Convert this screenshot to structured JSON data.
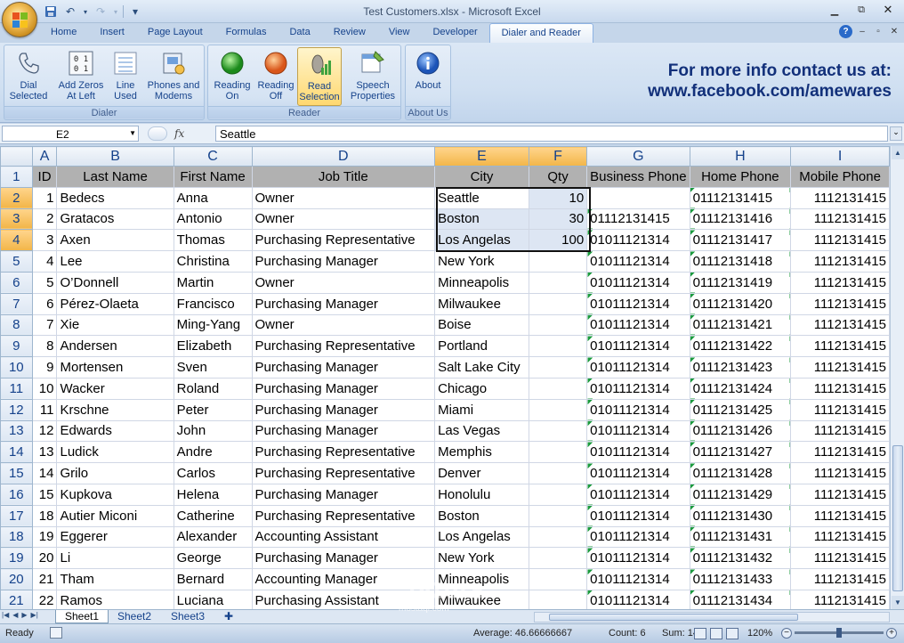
{
  "window": {
    "title": "Test Customers.xlsx - Microsoft Excel",
    "minimize": "▭",
    "restore": "⧉",
    "close": "✕"
  },
  "quick_access": {
    "save_icon": "💾",
    "undo_icon": "↶",
    "redo_icon": "↷",
    "customize_icon": "▾"
  },
  "tabs": [
    "Home",
    "Insert",
    "Page Layout",
    "Formulas",
    "Data",
    "Review",
    "View",
    "Developer",
    "Dialer and Reader"
  ],
  "active_tab": "Dialer and Reader",
  "ribbon": {
    "groups": [
      {
        "label": "Dialer",
        "buttons": [
          {
            "label": "Dial\nSelected",
            "icon": "phone-icon"
          },
          {
            "label": "Add Zeros\nAt Left",
            "icon": "zeros-icon"
          },
          {
            "label": "Line\nUsed",
            "icon": "line-icon"
          },
          {
            "label": "Phones and\nModems",
            "icon": "modem-icon"
          }
        ]
      },
      {
        "label": "Reader",
        "buttons": [
          {
            "label": "Reading\nOn",
            "icon": "green-circle-icon"
          },
          {
            "label": "Reading\nOff",
            "icon": "orange-circle-icon"
          },
          {
            "label": "Read\nSelection",
            "icon": "speaker-icon"
          },
          {
            "label": "Speech\nProperties",
            "icon": "speech-properties-icon"
          }
        ]
      },
      {
        "label": "About Us",
        "buttons": [
          {
            "label": "About",
            "icon": "info-icon"
          }
        ]
      }
    ],
    "promo_line1": "For more info contact us at:",
    "promo_line2": "www.facebook.com/amewares"
  },
  "formula_bar": {
    "name_box": "E2",
    "fx": "fx",
    "value": "Seattle"
  },
  "columns": [
    "A",
    "B",
    "C",
    "D",
    "E",
    "F",
    "G",
    "H",
    "I"
  ],
  "selected_columns": [
    "E",
    "F"
  ],
  "header_row": [
    "ID",
    "Last Name",
    "First Name",
    "Job Title",
    "City",
    "Qty",
    "Business Phone",
    "Home Phone",
    "Mobile Phone"
  ],
  "rows": [
    [
      "1",
      "Bedecs",
      "Anna",
      "Owner",
      "Seattle",
      "10",
      "",
      "01112131415",
      "1112131415"
    ],
    [
      "2",
      "Gratacos",
      "Antonio",
      "Owner",
      "Boston",
      "30",
      "01112131415",
      "01112131416",
      "1112131415"
    ],
    [
      "3",
      "Axen",
      "Thomas",
      "Purchasing Representative",
      "Los Angelas",
      "100",
      "01011121314",
      "01112131417",
      "1112131415"
    ],
    [
      "4",
      "Lee",
      "Christina",
      "Purchasing Manager",
      "New York",
      "",
      "01011121314",
      "01112131418",
      "1112131415"
    ],
    [
      "5",
      "O’Donnell",
      "Martin",
      "Owner",
      "Minneapolis",
      "",
      "01011121314",
      "01112131419",
      "1112131415"
    ],
    [
      "6",
      "Pérez-Olaeta",
      "Francisco",
      "Purchasing Manager",
      "Milwaukee",
      "",
      "01011121314",
      "01112131420",
      "1112131415"
    ],
    [
      "7",
      "Xie",
      "Ming-Yang",
      "Owner",
      "Boise",
      "",
      "01011121314",
      "01112131421",
      "1112131415"
    ],
    [
      "8",
      "Andersen",
      "Elizabeth",
      "Purchasing Representative",
      "Portland",
      "",
      "01011121314",
      "01112131422",
      "1112131415"
    ],
    [
      "9",
      "Mortensen",
      "Sven",
      "Purchasing Manager",
      "Salt Lake City",
      "",
      "01011121314",
      "01112131423",
      "1112131415"
    ],
    [
      "10",
      "Wacker",
      "Roland",
      "Purchasing Manager",
      "Chicago",
      "",
      "01011121314",
      "01112131424",
      "1112131415"
    ],
    [
      "11",
      "Krschne",
      "Peter",
      "Purchasing Manager",
      "Miami",
      "",
      "01011121314",
      "01112131425",
      "1112131415"
    ],
    [
      "12",
      "Edwards",
      "John",
      "Purchasing Manager",
      "Las Vegas",
      "",
      "01011121314",
      "01112131426",
      "1112131415"
    ],
    [
      "13",
      "Ludick",
      "Andre",
      "Purchasing Representative",
      "Memphis",
      "",
      "01011121314",
      "01112131427",
      "1112131415"
    ],
    [
      "14",
      "Grilo",
      "Carlos",
      "Purchasing Representative",
      "Denver",
      "",
      "01011121314",
      "01112131428",
      "1112131415"
    ],
    [
      "15",
      "Kupkova",
      "Helena",
      "Purchasing Manager",
      "Honolulu",
      "",
      "01011121314",
      "01112131429",
      "1112131415"
    ],
    [
      "18",
      "Autier Miconi",
      "Catherine",
      "Purchasing Representative",
      "Boston",
      "",
      "01011121314",
      "01112131430",
      "1112131415"
    ],
    [
      "19",
      "Eggerer",
      "Alexander",
      "Accounting Assistant",
      "Los Angelas",
      "",
      "01011121314",
      "01112131431",
      "1112131415"
    ],
    [
      "20",
      "Li",
      "George",
      "Purchasing Manager",
      "New York",
      "",
      "01011121314",
      "01112131432",
      "1112131415"
    ],
    [
      "21",
      "Tham",
      "Bernard",
      "Accounting Manager",
      "Minneapolis",
      "",
      "01011121314",
      "01112131433",
      "1112131415"
    ],
    [
      "22",
      "Ramos",
      "Luciana",
      "Purchasing Assistant",
      "Milwaukee",
      "",
      "01011121314",
      "01112131434",
      "1112131415"
    ]
  ],
  "sheet_tabs": [
    "Sheet1",
    "Sheet2",
    "Sheet3"
  ],
  "active_sheet": "Sheet1",
  "status": {
    "ready": "Ready",
    "average": "Average: 46.66666667",
    "count": "Count: 6",
    "sum": "Sum: 140",
    "zoom": "120%"
  },
  "watermark": "مستقل",
  "watermark_sub": "mostaql.com"
}
